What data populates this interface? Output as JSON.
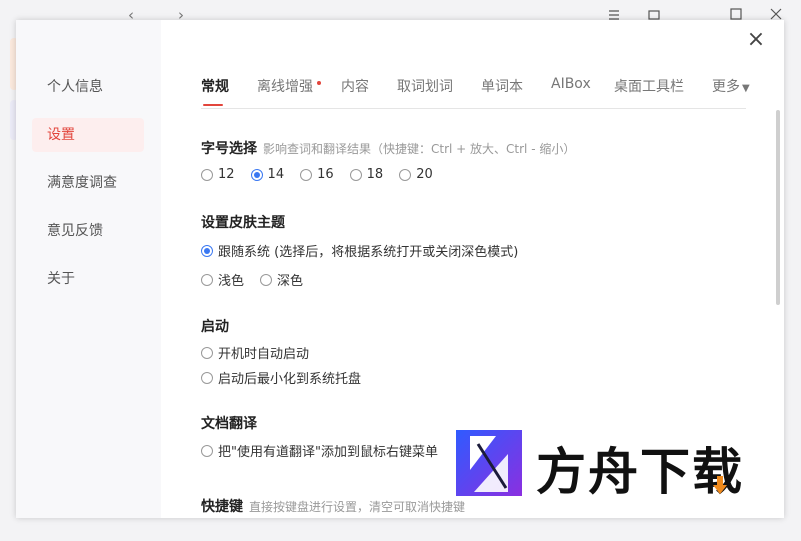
{
  "background": {
    "back_glyph": "‹",
    "forward_glyph": "›"
  },
  "sidebar": {
    "items": [
      {
        "label": "个人信息"
      },
      {
        "label": "设置"
      },
      {
        "label": "满意度调查"
      },
      {
        "label": "意见反馈"
      },
      {
        "label": "关于"
      }
    ],
    "active_index": 1
  },
  "close_glyph": "×",
  "tabs": [
    {
      "label": "常规"
    },
    {
      "label": "离线增强",
      "has_dot": true
    },
    {
      "label": "内容"
    },
    {
      "label": "取词划词"
    },
    {
      "label": "单词本"
    },
    {
      "label": "AIBox"
    },
    {
      "label": "桌面工具栏"
    },
    {
      "label": "更多"
    }
  ],
  "font_size": {
    "title": "字号选择",
    "hint": "影响查词和翻译结果（快捷键：Ctrl + 放大、Ctrl - 缩小）",
    "options": [
      "12",
      "14",
      "16",
      "18",
      "20"
    ],
    "selected": "14"
  },
  "skin": {
    "title": "设置皮肤主题",
    "follow_system": "跟随系统 (选择后，将根据系统打开或关闭深色模式)",
    "light": "浅色",
    "dark": "深色",
    "selected": "follow_system"
  },
  "startup": {
    "title": "启动",
    "auto_start": "开机时自动启动",
    "minimize_tray": "启动后最小化到系统托盘"
  },
  "doc_translate": {
    "title": "文档翻译",
    "context_menu": "把\"使用有道翻译\"添加到鼠标右键菜单"
  },
  "hotkey": {
    "title": "快捷键",
    "hint": "直接按键盘进行设置，清空可取消快捷键"
  },
  "watermark": {
    "text": "方舟下载"
  },
  "colors": {
    "accent": "#e2453c",
    "radio_checked": "#3a78f2"
  }
}
